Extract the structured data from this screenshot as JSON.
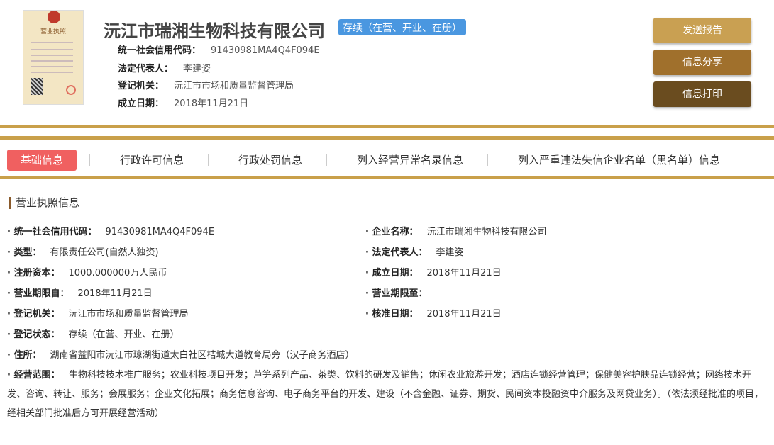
{
  "header": {
    "company_name": "沅江市瑞湘生物科技有限公司",
    "status_badge": "存续（在营、开业、在册）",
    "license_title": "营业执照",
    "rows": [
      {
        "label": "统一社会信用代码：",
        "value": "91430981MA4Q4F094E"
      },
      {
        "label": "法定代表人：",
        "value": "李建姿"
      },
      {
        "label": "登记机关：",
        "value": "沅江市市场和质量监督管理局"
      },
      {
        "label": "成立日期：",
        "value": "2018年11月21日"
      }
    ]
  },
  "actions": {
    "send_report": "发送报告",
    "share": "信息分享",
    "print": "信息打印"
  },
  "tabs": [
    "基础信息",
    "行政许可信息",
    "行政处罚信息",
    "列入经营异常名录信息",
    "列入严重违法失信企业名单（黑名单）信息"
  ],
  "section_title": "营业执照信息",
  "fields": {
    "credit_code": {
      "label": "统一社会信用代码：",
      "value": "91430981MA4Q4F094E"
    },
    "company_name": {
      "label": "企业名称：",
      "value": "沅江市瑞湘生物科技有限公司"
    },
    "type": {
      "label": "类型：",
      "value": "有限责任公司(自然人独资)"
    },
    "legal_rep": {
      "label": "法定代表人：",
      "value": "李建姿"
    },
    "capital": {
      "label": "注册资本：",
      "value": "1000.000000万人民币"
    },
    "established": {
      "label": "成立日期：",
      "value": "2018年11月21日"
    },
    "term_from": {
      "label": "营业期限自：",
      "value": "2018年11月21日"
    },
    "term_to": {
      "label": "营业期限至：",
      "value": ""
    },
    "authority": {
      "label": "登记机关：",
      "value": "沅江市市场和质量监督管理局"
    },
    "approval_date": {
      "label": "核准日期：",
      "value": "2018年11月21日"
    },
    "reg_status": {
      "label": "登记状态：",
      "value": "存续（在营、开业、在册）"
    },
    "address": {
      "label": "住所：",
      "value": "湖南省益阳市沅江市琼湖街道太白社区桔城大道教育局旁（汉子商务酒店）"
    },
    "scope": {
      "label": "经营范围：",
      "value": "生物科技技术推广服务；农业科技项目开发；芦笋系列产品、茶类、饮料的研发及销售；休闲农业旅游开发；酒店连锁经营管理；保健美容护肤品连锁经营；网络技术开发、咨询、转让、服务；会展服务；企业文化拓展；商务信息咨询、电子商务平台的开发、建设（不含金融、证券、期货、民间资本投融资中介服务及网贷业务）。（依法须经批准的项目，经相关部门批准后方可开展经营活动）"
    }
  }
}
